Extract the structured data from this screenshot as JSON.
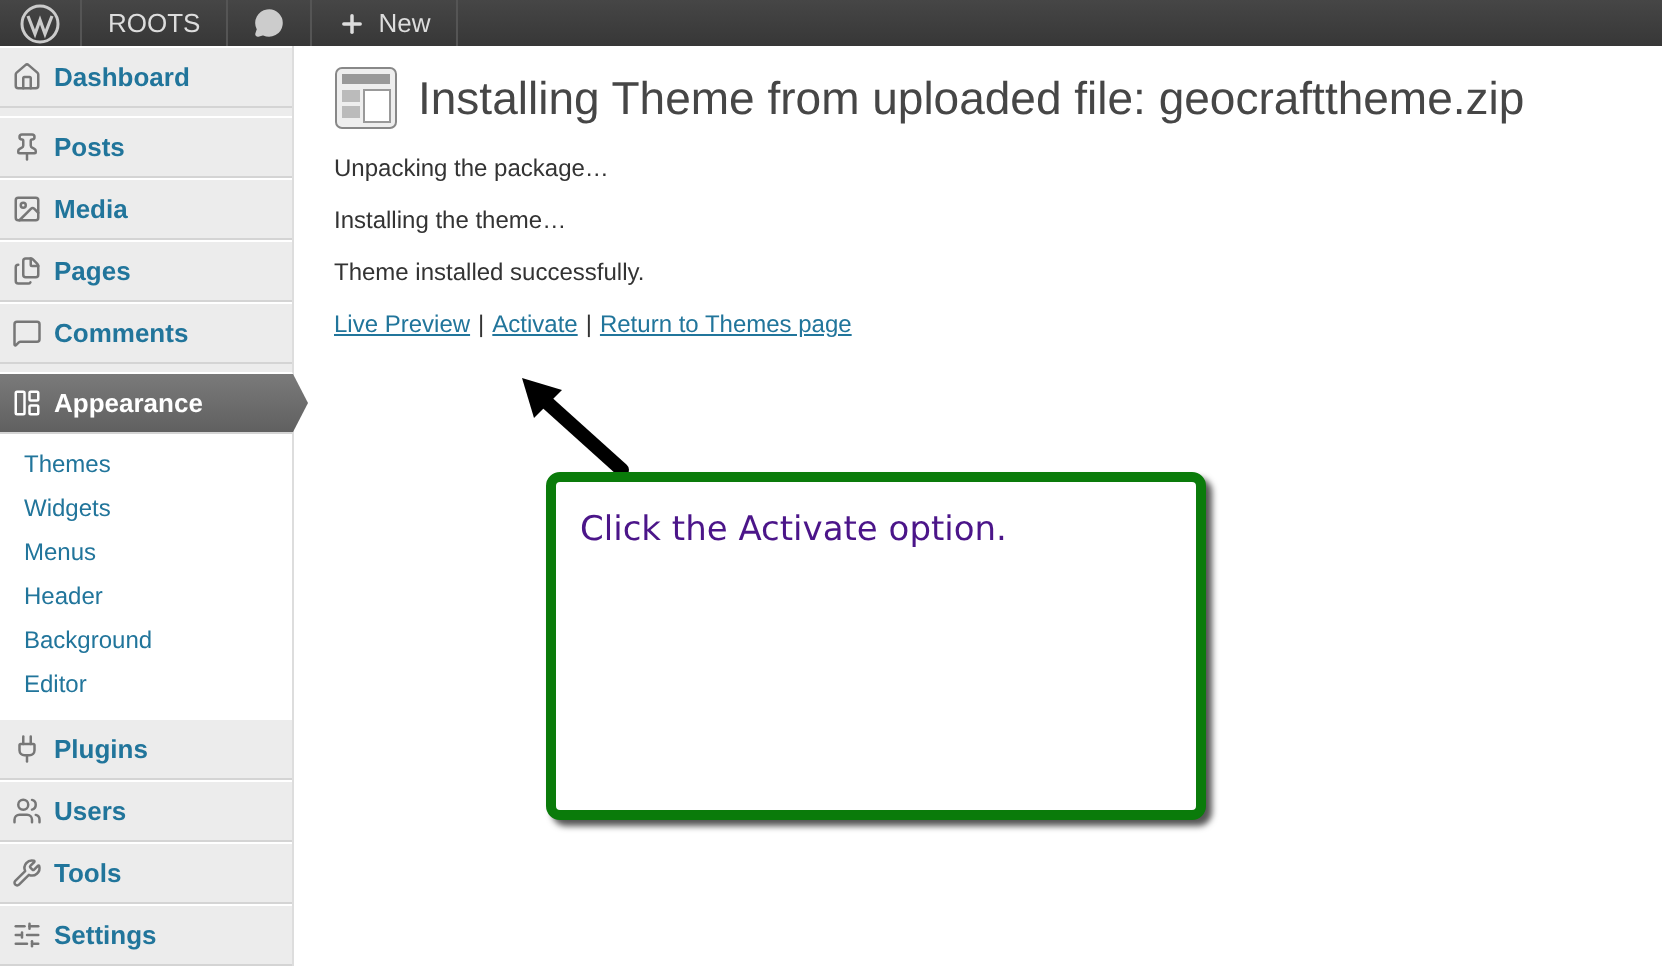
{
  "admin_bar": {
    "site_name": "ROOTS",
    "new_label": "New"
  },
  "sidebar": {
    "items": [
      {
        "label": "Dashboard",
        "selected": false
      },
      {
        "label": "Posts",
        "selected": false
      },
      {
        "label": "Media",
        "selected": false
      },
      {
        "label": "Pages",
        "selected": false
      },
      {
        "label": "Comments",
        "selected": false
      },
      {
        "label": "Appearance",
        "selected": true,
        "children": [
          {
            "label": "Themes"
          },
          {
            "label": "Widgets"
          },
          {
            "label": "Menus"
          },
          {
            "label": "Header"
          },
          {
            "label": "Background"
          },
          {
            "label": "Editor"
          }
        ]
      },
      {
        "label": "Plugins",
        "selected": false
      },
      {
        "label": "Users",
        "selected": false
      },
      {
        "label": "Tools",
        "selected": false
      },
      {
        "label": "Settings",
        "selected": false
      }
    ]
  },
  "page": {
    "title": "Installing Theme from uploaded file: geocrafttheme.zip",
    "messages": [
      "Unpacking the package…",
      "Installing the theme…",
      "Theme installed successfully."
    ],
    "links": [
      "Live Preview",
      "Activate",
      "Return to Themes page"
    ],
    "link_separator": "|"
  },
  "callout": {
    "text": "Click the Activate option."
  }
}
